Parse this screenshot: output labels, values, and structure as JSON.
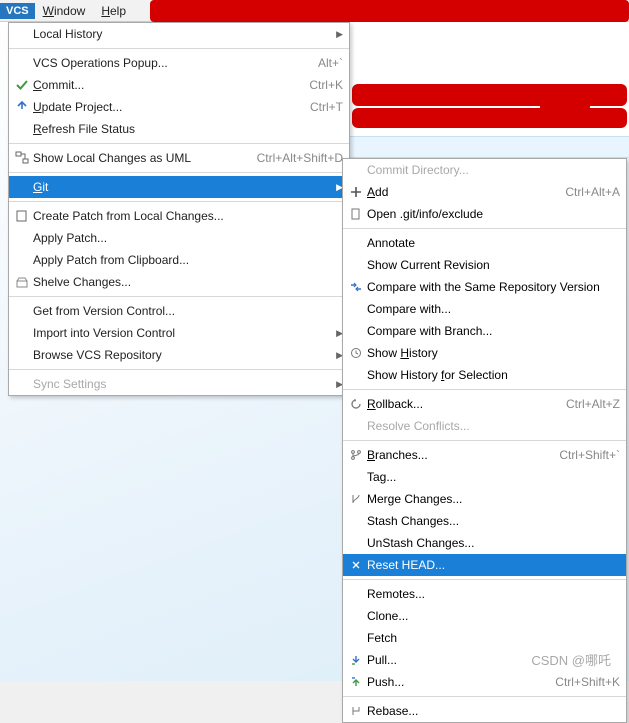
{
  "menubar": {
    "vcs": "VCS",
    "window": "Window",
    "help": "Help"
  },
  "menu": {
    "local_history": "Local History",
    "vcs_operations_popup": "VCS Operations Popup...",
    "vcs_operations_popup_sc": "Alt+`",
    "commit": "Commit...",
    "commit_sc": "Ctrl+K",
    "update_project": "Update Project...",
    "update_project_sc": "Ctrl+T",
    "refresh_file_status": "Refresh File Status",
    "show_local_changes_uml": "Show Local Changes as UML",
    "show_local_changes_uml_sc": "Ctrl+Alt+Shift+D",
    "git": "Git",
    "create_patch": "Create Patch from Local Changes...",
    "apply_patch": "Apply Patch...",
    "apply_patch_clipboard": "Apply Patch from Clipboard...",
    "shelve_changes": "Shelve Changes...",
    "get_from_vc": "Get from Version Control...",
    "import_into_vc": "Import into Version Control",
    "browse_vcs_repo": "Browse VCS Repository",
    "sync_settings": "Sync Settings"
  },
  "git": {
    "commit_directory": "Commit Directory...",
    "add": "Add",
    "add_sc": "Ctrl+Alt+A",
    "open_git_info_exclude": "Open .git/info/exclude",
    "annotate": "Annotate",
    "show_current_revision": "Show Current Revision",
    "compare_same_repo": "Compare with the Same Repository Version",
    "compare_with": "Compare with...",
    "compare_with_branch": "Compare with Branch...",
    "show_history": "Show History",
    "show_history_selection": "Show History for Selection",
    "rollback": "Rollback...",
    "rollback_sc": "Ctrl+Alt+Z",
    "resolve_conflicts": "Resolve Conflicts...",
    "branches": "Branches...",
    "branches_sc": "Ctrl+Shift+`",
    "tag": "Tag...",
    "merge_changes": "Merge Changes...",
    "stash_changes": "Stash Changes...",
    "unstash_changes": "UnStash Changes...",
    "reset_head": "Reset HEAD...",
    "remotes": "Remotes...",
    "clone": "Clone...",
    "fetch": "Fetch",
    "pull": "Pull...",
    "push": "Push...",
    "push_sc": "Ctrl+Shift+K",
    "rebase": "Rebase..."
  },
  "watermark": "CSDN @哪吒"
}
